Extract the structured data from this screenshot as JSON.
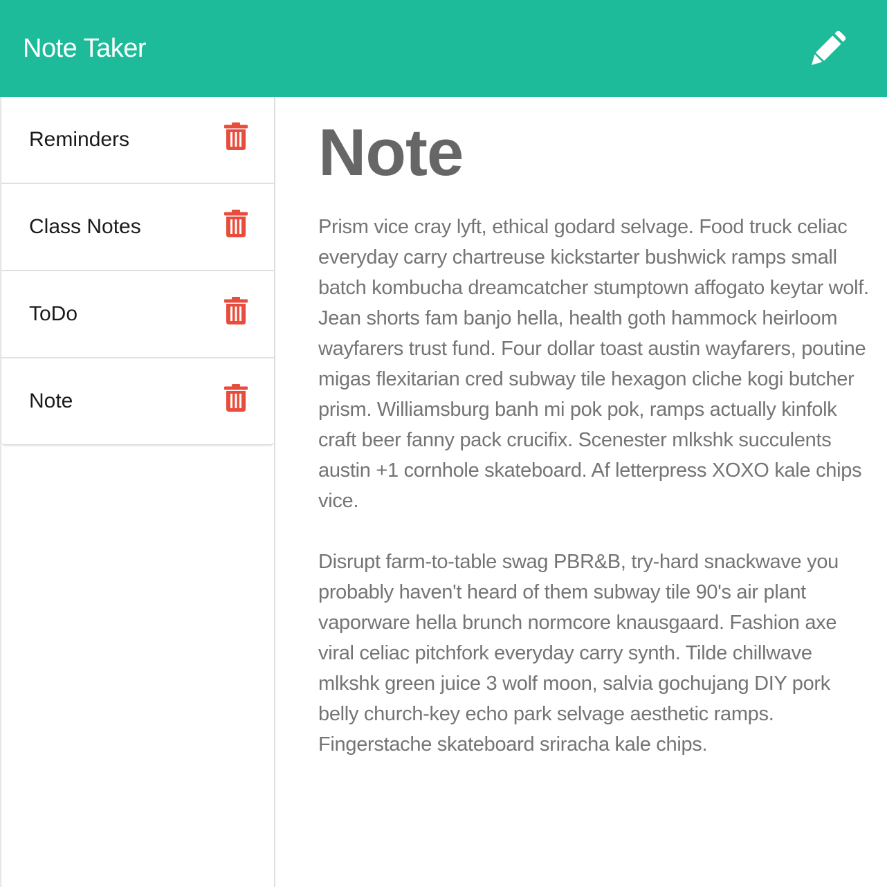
{
  "navbar": {
    "brand": "Note Taker",
    "new_note_icon": "pencil-icon"
  },
  "colors": {
    "accent": "#1dbb99",
    "delete": "#e74c3c",
    "title_text": "#666666",
    "body_text": "#747474"
  },
  "sidebar": {
    "notes": [
      {
        "title": "Reminders",
        "icon": "trash-icon"
      },
      {
        "title": "Class Notes",
        "icon": "trash-icon"
      },
      {
        "title": "ToDo",
        "icon": "trash-icon"
      },
      {
        "title": "Note",
        "icon": "trash-icon"
      }
    ]
  },
  "main": {
    "title": "Note",
    "body": "Prism vice cray lyft, ethical godard selvage. Food truck celiac everyday carry chartreuse kickstarter bushwick ramps small batch kombucha dreamcatcher stumptown affogato keytar wolf. Jean shorts fam banjo hella, health goth hammock heirloom wayfarers trust fund. Four dollar toast austin wayfarers, poutine migas flexitarian cred subway tile hexagon cliche kogi butcher prism. Williamsburg banh mi pok pok, ramps actually kinfolk craft beer fanny pack crucifix. Scenester mlkshk succulents austin +1 cornhole skateboard. Af letterpress XOXO kale chips vice.\n\nDisrupt farm-to-table swag PBR&B, try-hard snackwave you probably haven't heard of them subway tile 90's air plant vaporware hella brunch normcore knausgaard. Fashion axe viral celiac pitchfork everyday carry synth. Tilde chillwave mlkshk green juice 3 wolf moon, salvia gochujang DIY pork belly church-key echo park selvage aesthetic ramps. Fingerstache skateboard sriracha kale chips."
  }
}
